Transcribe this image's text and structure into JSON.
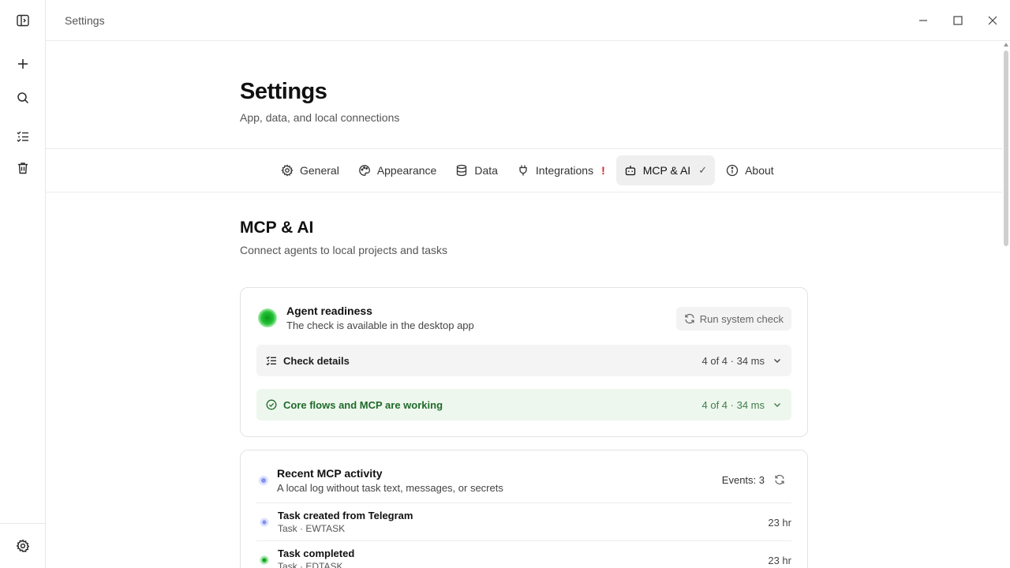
{
  "window": {
    "title": "Settings"
  },
  "header": {
    "title": "Settings",
    "subtitle": "App, data, and local connections"
  },
  "tabs": [
    {
      "label": "General",
      "icon": "gear-icon"
    },
    {
      "label": "Appearance",
      "icon": "palette-icon"
    },
    {
      "label": "Data",
      "icon": "database-icon"
    },
    {
      "label": "Integrations",
      "icon": "plug-icon",
      "badge": "!"
    },
    {
      "label": "MCP & AI",
      "icon": "bot-icon",
      "badge": "✓",
      "active": true
    },
    {
      "label": "About",
      "icon": "info-icon"
    }
  ],
  "section": {
    "title": "MCP & AI",
    "subtitle": "Connect agents to local projects and tasks"
  },
  "readiness": {
    "title": "Agent readiness",
    "subtitle": "The check is available in the desktop app",
    "run_button": "Run system check",
    "details_label": "Check details",
    "details_meta": "4 of 4 · 34 ms",
    "status_label": "Core flows and MCP are working",
    "status_meta": "4 of 4 · 34 ms",
    "status_color": "#1f6b2a"
  },
  "activity": {
    "title": "Recent MCP activity",
    "subtitle": "A local log without task text, messages, or secrets",
    "events_count": "Events: 3",
    "events": [
      {
        "title": "Task created from Telegram",
        "sub": "Task · EWTASK",
        "time": "23 hr"
      },
      {
        "title": "Task completed",
        "sub": "Task · EDTASK",
        "time": "23 hr"
      }
    ]
  },
  "colors": {
    "accent_green": "#22c136",
    "error_red": "#d21f2b",
    "active_tab_bg": "#efefef"
  }
}
